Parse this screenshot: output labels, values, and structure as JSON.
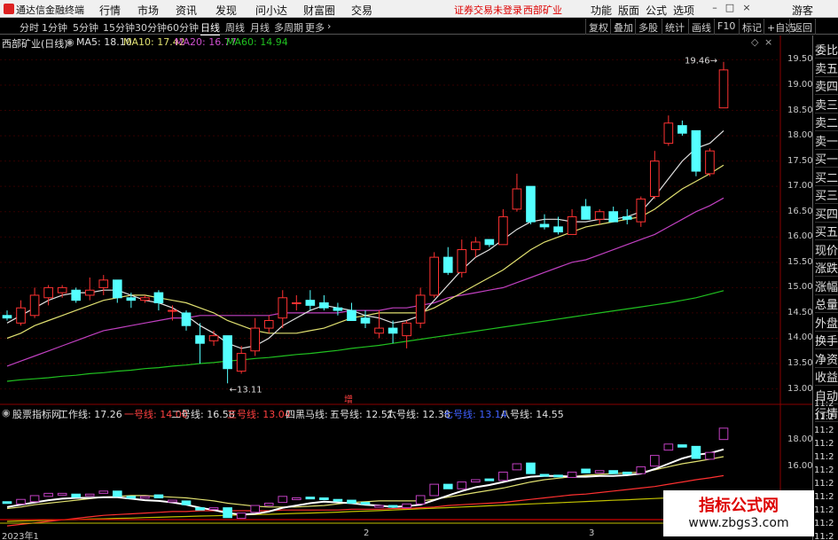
{
  "menubar": {
    "app_title": "通达信金融终端",
    "items": [
      "行情",
      "市场",
      "资讯",
      "发现",
      "问小达",
      "财富圈",
      "交易"
    ],
    "warning": "证券交易未登录",
    "stock_name": "西部矿业",
    "right_items": [
      "功能",
      "版面",
      "公式",
      "选项"
    ],
    "guest": "游客",
    "win_min": "–",
    "win_max": "□",
    "win_close": "×"
  },
  "toolbar": {
    "periods": [
      "分时",
      "1分钟",
      "5分钟",
      "15分钟",
      "30分钟",
      "60分钟",
      "日线",
      "周线",
      "月线",
      "多周期",
      "更多"
    ],
    "active_period": "日线",
    "right_buttons": [
      "复权",
      "叠加",
      "多股",
      "统计",
      "画线",
      "F10",
      "标记",
      "+自选",
      "返回"
    ]
  },
  "main_header": {
    "title": "西部矿业(日线)",
    "ma5": "MA5: 18.10",
    "ma10": "MA10: 17.42",
    "ma20": "MA20: 16.77",
    "ma60": "MA60: 14.94"
  },
  "sub_header": {
    "title": "股票指标网",
    "lines": [
      {
        "label": "工作线: 17.26",
        "color": "#e0e0e0"
      },
      {
        "label": "一号线: 14.00",
        "color": "#ff4040"
      },
      {
        "label": "二号线: 16.58",
        "color": "#e0e0e0"
      },
      {
        "label": "三号线: 13.04",
        "color": "#ff4040"
      },
      {
        "label": "四黑马线: -",
        "color": "#e0e0e0"
      },
      {
        "label": "五号线: 12.51",
        "color": "#e0e0e0"
      },
      {
        "label": "六号线: 12.38",
        "color": "#e0e0e0"
      },
      {
        "label": "七号线: 13.14",
        "color": "#4060ff"
      },
      {
        "label": "八号线: 14.55",
        "color": "#e0e0e0"
      }
    ]
  },
  "annotations": {
    "high": "19.46",
    "low": "13.11",
    "zeng": "增"
  },
  "price_axis": [
    "19.50",
    "19.00",
    "18.50",
    "18.00",
    "17.50",
    "17.00",
    "16.50",
    "16.00",
    "15.50",
    "15.00",
    "14.50",
    "14.00",
    "13.50",
    "13.00"
  ],
  "sub_axis": [
    "18.00",
    "16.00"
  ],
  "dates": [
    "2023年1",
    "2",
    "3"
  ],
  "right_panel": {
    "items": [
      "委比",
      "卖五",
      "卖四",
      "卖三",
      "卖二",
      "卖一",
      "买一",
      "买二",
      "买三",
      "买四",
      "买五",
      "现价",
      "涨跌",
      "涨幅",
      "总量",
      "外盘",
      "换手",
      "净资",
      "收益",
      "自动",
      "行情"
    ],
    "times": [
      "11:2",
      "11:2",
      "11:2",
      "11:2",
      "11:2",
      "11:2",
      "11:2",
      "11:2",
      "11:2",
      "11:2",
      "11:2"
    ]
  },
  "watermark": {
    "line1": "指标公式网",
    "line2": "www.zbgs3.com"
  },
  "colors": {
    "up": "#ff3232",
    "down": "#54ffff",
    "ma5": "#e0e0e0",
    "ma10": "#e0e070",
    "ma20": "#c040c0",
    "ma60": "#20c020"
  },
  "chart_data": {
    "type": "candlestick",
    "y_range": [
      12.8,
      19.7
    ],
    "candles": [
      {
        "o": 14.45,
        "h": 14.55,
        "l": 14.35,
        "c": 14.4
      },
      {
        "o": 14.3,
        "h": 14.75,
        "l": 14.25,
        "c": 14.6
      },
      {
        "o": 14.45,
        "h": 15.0,
        "l": 14.4,
        "c": 14.85
      },
      {
        "o": 14.8,
        "h": 15.05,
        "l": 14.65,
        "c": 15.0
      },
      {
        "o": 14.9,
        "h": 15.05,
        "l": 14.8,
        "c": 15.0
      },
      {
        "o": 14.95,
        "h": 15.0,
        "l": 14.7,
        "c": 14.75
      },
      {
        "o": 14.85,
        "h": 15.2,
        "l": 14.75,
        "c": 14.95
      },
      {
        "o": 15.0,
        "h": 15.25,
        "l": 14.85,
        "c": 15.15
      },
      {
        "o": 15.15,
        "h": 15.15,
        "l": 14.7,
        "c": 14.8
      },
      {
        "o": 14.8,
        "h": 14.9,
        "l": 14.6,
        "c": 14.75
      },
      {
        "o": 14.75,
        "h": 14.85,
        "l": 14.7,
        "c": 14.8
      },
      {
        "o": 14.9,
        "h": 14.95,
        "l": 14.55,
        "c": 14.7
      },
      {
        "o": 14.55,
        "h": 14.65,
        "l": 14.35,
        "c": 14.55
      },
      {
        "o": 14.5,
        "h": 14.55,
        "l": 14.15,
        "c": 14.25
      },
      {
        "o": 14.05,
        "h": 14.3,
        "l": 13.5,
        "c": 13.9
      },
      {
        "o": 13.95,
        "h": 14.15,
        "l": 13.85,
        "c": 14.05
      },
      {
        "o": 14.05,
        "h": 14.05,
        "l": 13.11,
        "c": 13.4
      },
      {
        "o": 13.35,
        "h": 13.85,
        "l": 13.3,
        "c": 13.7
      },
      {
        "o": 13.75,
        "h": 14.4,
        "l": 13.65,
        "c": 14.2
      },
      {
        "o": 14.2,
        "h": 14.45,
        "l": 14.1,
        "c": 14.35
      },
      {
        "o": 14.4,
        "h": 14.95,
        "l": 14.2,
        "c": 14.8
      },
      {
        "o": 14.7,
        "h": 14.85,
        "l": 14.55,
        "c": 14.7
      },
      {
        "o": 14.75,
        "h": 14.95,
        "l": 14.55,
        "c": 14.65
      },
      {
        "o": 14.7,
        "h": 14.85,
        "l": 14.55,
        "c": 14.6
      },
      {
        "o": 14.6,
        "h": 14.7,
        "l": 14.45,
        "c": 14.55
      },
      {
        "o": 14.55,
        "h": 14.7,
        "l": 14.35,
        "c": 14.35
      },
      {
        "o": 14.4,
        "h": 14.55,
        "l": 14.2,
        "c": 14.3
      },
      {
        "o": 14.1,
        "h": 14.55,
        "l": 14.0,
        "c": 14.2
      },
      {
        "o": 14.2,
        "h": 14.35,
        "l": 13.9,
        "c": 14.1
      },
      {
        "o": 14.05,
        "h": 14.35,
        "l": 13.8,
        "c": 14.3
      },
      {
        "o": 14.3,
        "h": 15.0,
        "l": 14.2,
        "c": 14.85
      },
      {
        "o": 14.85,
        "h": 15.7,
        "l": 14.8,
        "c": 15.6
      },
      {
        "o": 15.6,
        "h": 15.8,
        "l": 15.25,
        "c": 15.3
      },
      {
        "o": 15.3,
        "h": 15.95,
        "l": 15.2,
        "c": 15.75
      },
      {
        "o": 15.75,
        "h": 16.0,
        "l": 15.6,
        "c": 15.9
      },
      {
        "o": 15.95,
        "h": 15.95,
        "l": 15.8,
        "c": 15.85
      },
      {
        "o": 15.85,
        "h": 16.55,
        "l": 15.85,
        "c": 16.4
      },
      {
        "o": 16.55,
        "h": 17.25,
        "l": 16.5,
        "c": 16.95
      },
      {
        "o": 17.0,
        "h": 17.0,
        "l": 16.25,
        "c": 16.3
      },
      {
        "o": 16.25,
        "h": 16.45,
        "l": 16.15,
        "c": 16.2
      },
      {
        "o": 16.2,
        "h": 16.4,
        "l": 16.05,
        "c": 16.1
      },
      {
        "o": 16.05,
        "h": 16.55,
        "l": 16.05,
        "c": 16.4
      },
      {
        "o": 16.6,
        "h": 16.75,
        "l": 16.35,
        "c": 16.35
      },
      {
        "o": 16.35,
        "h": 16.55,
        "l": 16.25,
        "c": 16.5
      },
      {
        "o": 16.5,
        "h": 16.6,
        "l": 16.3,
        "c": 16.3
      },
      {
        "o": 16.4,
        "h": 16.55,
        "l": 16.25,
        "c": 16.35
      },
      {
        "o": 16.3,
        "h": 16.8,
        "l": 16.2,
        "c": 16.75
      },
      {
        "o": 16.8,
        "h": 17.7,
        "l": 16.75,
        "c": 17.5
      },
      {
        "o": 17.85,
        "h": 18.4,
        "l": 17.8,
        "c": 18.25
      },
      {
        "o": 18.2,
        "h": 18.3,
        "l": 18.0,
        "c": 18.05
      },
      {
        "o": 18.1,
        "h": 18.1,
        "l": 17.2,
        "c": 17.3
      },
      {
        "o": 17.25,
        "h": 17.75,
        "l": 17.2,
        "c": 17.7
      },
      {
        "o": 18.55,
        "h": 19.46,
        "l": 18.55,
        "c": 19.3
      }
    ],
    "ma5": [
      14.3,
      14.45,
      14.6,
      14.75,
      14.85,
      14.9,
      14.9,
      14.95,
      14.95,
      14.85,
      14.75,
      14.7,
      14.6,
      14.45,
      14.25,
      14.1,
      13.9,
      13.8,
      13.85,
      14.0,
      14.25,
      14.4,
      14.55,
      14.65,
      14.6,
      14.55,
      14.45,
      14.4,
      14.3,
      14.35,
      14.45,
      14.75,
      15.05,
      15.35,
      15.6,
      15.75,
      15.95,
      16.15,
      16.3,
      16.35,
      16.35,
      16.3,
      16.3,
      16.35,
      16.35,
      16.4,
      16.5,
      16.8,
      17.15,
      17.5,
      17.75,
      17.85,
      18.1
    ],
    "ma10": [
      14.0,
      14.1,
      14.25,
      14.35,
      14.45,
      14.55,
      14.65,
      14.75,
      14.8,
      14.85,
      14.85,
      14.8,
      14.75,
      14.7,
      14.6,
      14.5,
      14.35,
      14.25,
      14.15,
      14.1,
      14.1,
      14.1,
      14.15,
      14.2,
      14.3,
      14.4,
      14.45,
      14.5,
      14.5,
      14.5,
      14.5,
      14.6,
      14.75,
      14.9,
      15.05,
      15.2,
      15.35,
      15.55,
      15.75,
      15.9,
      16.0,
      16.1,
      16.2,
      16.25,
      16.3,
      16.35,
      16.4,
      16.55,
      16.75,
      16.95,
      17.1,
      17.25,
      17.42
    ],
    "ma20": [
      13.45,
      13.55,
      13.65,
      13.75,
      13.85,
      13.95,
      14.05,
      14.15,
      14.2,
      14.25,
      14.3,
      14.35,
      14.4,
      14.4,
      14.45,
      14.45,
      14.45,
      14.45,
      14.45,
      14.45,
      14.5,
      14.5,
      14.5,
      14.5,
      14.5,
      14.55,
      14.55,
      14.55,
      14.6,
      14.6,
      14.65,
      14.7,
      14.8,
      14.85,
      14.9,
      14.95,
      15.0,
      15.1,
      15.2,
      15.3,
      15.4,
      15.5,
      15.55,
      15.65,
      15.75,
      15.85,
      15.95,
      16.05,
      16.2,
      16.35,
      16.5,
      16.62,
      16.77
    ],
    "ma60": [
      13.15,
      13.18,
      13.2,
      13.22,
      13.25,
      13.27,
      13.3,
      13.32,
      13.35,
      13.37,
      13.4,
      13.42,
      13.45,
      13.47,
      13.5,
      13.52,
      13.55,
      13.57,
      13.6,
      13.62,
      13.65,
      13.68,
      13.7,
      13.73,
      13.76,
      13.8,
      13.83,
      13.86,
      13.9,
      13.94,
      13.98,
      14.02,
      14.06,
      14.1,
      14.14,
      14.18,
      14.22,
      14.26,
      14.3,
      14.34,
      14.38,
      14.42,
      14.46,
      14.5,
      14.54,
      14.58,
      14.62,
      14.66,
      14.7,
      14.75,
      14.8,
      14.87,
      14.94
    ]
  }
}
